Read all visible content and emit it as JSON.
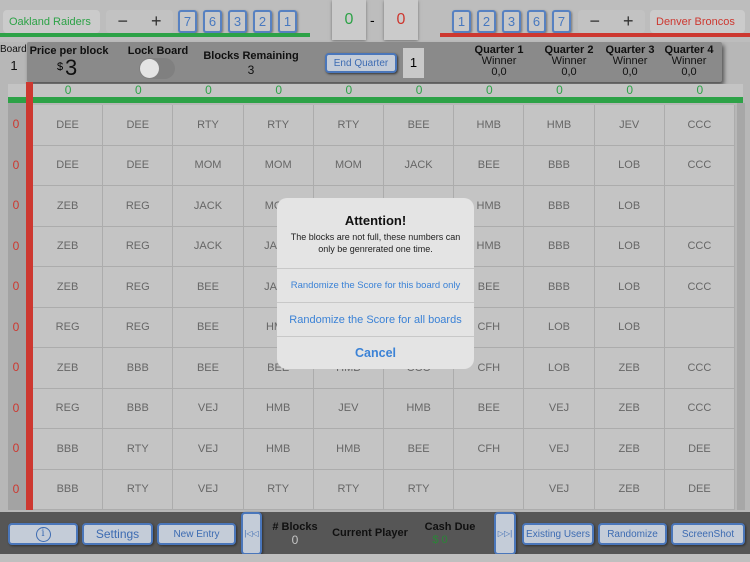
{
  "header": {
    "home_team": "Oakland Raiders",
    "away_team": "Denver Broncos",
    "home_score": "0",
    "away_score": "0",
    "score_separator": "-",
    "minus": "−",
    "plus": "+",
    "home_digits": [
      "7",
      "6",
      "3",
      "2",
      "1"
    ],
    "away_digits": [
      "1",
      "2",
      "3",
      "6",
      "7"
    ]
  },
  "board": {
    "label": "Board",
    "number": "1"
  },
  "panel": {
    "price_label": "Price per block",
    "price_currency": "$",
    "price_value": "3",
    "lock_label": "Lock Board",
    "lock_on": false,
    "blocks_remaining_label": "Blocks Remaining",
    "blocks_remaining_value": "3",
    "end_quarter": "End Quarter",
    "current_quarter": "1",
    "quarters": [
      {
        "title": "Quarter 1",
        "sub": "Winner",
        "score": "0,0"
      },
      {
        "title": "Quarter 2",
        "sub": "Winner",
        "score": "0,0"
      },
      {
        "title": "Quarter 3",
        "sub": "Winner",
        "score": "0,0"
      },
      {
        "title": "Quarter 4",
        "sub": "Winner",
        "score": "0,0"
      }
    ]
  },
  "grid": {
    "col_numbers": [
      "0",
      "0",
      "0",
      "0",
      "0",
      "0",
      "0",
      "0",
      "0",
      "0"
    ],
    "row_numbers": [
      "0",
      "0",
      "0",
      "0",
      "0",
      "0",
      "0",
      "0",
      "0",
      "0"
    ],
    "rows": [
      [
        "DEE",
        "DEE",
        "RTY",
        "RTY",
        "RTY",
        "BEE",
        "HMB",
        "HMB",
        "JEV",
        "CCC"
      ],
      [
        "DEE",
        "DEE",
        "MOM",
        "MOM",
        "MOM",
        "JACK",
        "BEE",
        "BBB",
        "LOB",
        "CCC"
      ],
      [
        "ZEB",
        "REG",
        "JACK",
        "MOM",
        "",
        "",
        "HMB",
        "BBB",
        "LOB",
        ""
      ],
      [
        "ZEB",
        "REG",
        "JACK",
        "JACK",
        "",
        "",
        "HMB",
        "BBB",
        "LOB",
        "CCC"
      ],
      [
        "ZEB",
        "REG",
        "BEE",
        "JACK",
        "",
        "",
        "BEE",
        "BBB",
        "LOB",
        "CCC"
      ],
      [
        "REG",
        "REG",
        "BEE",
        "HMB",
        "",
        "",
        "CFH",
        "LOB",
        "LOB",
        ""
      ],
      [
        "ZEB",
        "BBB",
        "BEE",
        "BEE",
        "HMB",
        "CCC",
        "CFH",
        "LOB",
        "ZEB",
        "CCC"
      ],
      [
        "REG",
        "BBB",
        "VEJ",
        "HMB",
        "JEV",
        "HMB",
        "BEE",
        "VEJ",
        "ZEB",
        "CCC"
      ],
      [
        "BBB",
        "RTY",
        "VEJ",
        "HMB",
        "HMB",
        "BEE",
        "CFH",
        "VEJ",
        "ZEB",
        "DEE"
      ],
      [
        "BBB",
        "RTY",
        "VEJ",
        "RTY",
        "RTY",
        "RTY",
        "",
        "VEJ",
        "ZEB",
        "DEE"
      ]
    ]
  },
  "dialog": {
    "title": "Attention!",
    "message": "The blocks are not full, these numbers can only be genrerated one time.",
    "option_board": "Randomize the Score for this board only",
    "option_all": "Randomize the Score for all boards",
    "cancel": "Cancel"
  },
  "footer": {
    "info_icon": "i",
    "settings": "Settings",
    "new_entry": "New Entry",
    "prev_icon": "|◁◁",
    "next_icon": "▷▷|",
    "blocks_label": "# Blocks",
    "blocks_value": "0",
    "current_player_label": "Current Player",
    "cash_due_label": "Cash Due",
    "cash_due_value": "$ 0",
    "existing_users": "Existing Users",
    "randomize": "Randomize",
    "screenshot": "ScreenShot"
  },
  "colors": {
    "home": "#2fa84a",
    "away": "#d43a32",
    "accent": "#3f6fb8"
  }
}
